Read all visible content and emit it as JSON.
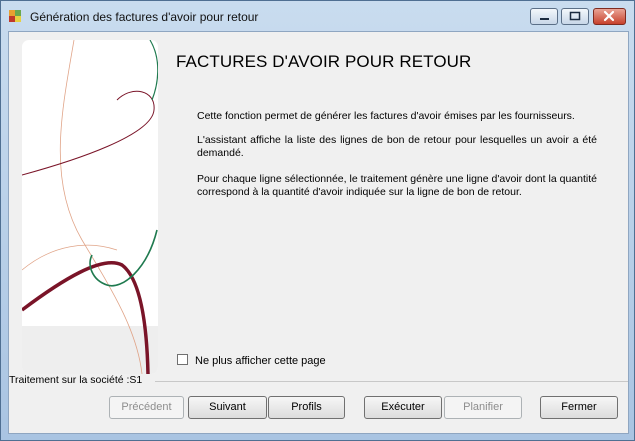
{
  "window": {
    "title": "Génération des factures d'avoir pour retour",
    "icon": "app-icon",
    "controls": [
      "minimize-icon",
      "maximize-icon",
      "close-icon"
    ]
  },
  "heading": "FACTURES D'AVOIR POUR RETOUR",
  "paragraphs": [
    "Cette fonction permet de générer les factures d'avoir émises par les fournisseurs.",
    "L'assistant affiche la liste des lignes de bon de retour pour lesquelles un avoir a été demandé.",
    "Pour chaque ligne sélectionnée, le traitement génère une ligne d'avoir dont la quantité correspond à la quantité d'avoir indiquée sur la ligne de bon de retour."
  ],
  "checkbox": {
    "label": "Ne plus afficher cette page",
    "checked": false
  },
  "status": "Traitement sur la société :S1",
  "buttons": {
    "previous": "Précédent",
    "next": "Suivant",
    "profiles": "Profils",
    "execute": "Exécuter",
    "schedule": "Planifier",
    "close": "Fermer"
  },
  "colors": {
    "accent_red": "#7a1428",
    "accent_green": "#1f7a4f",
    "accent_tan": "#e0a488"
  }
}
